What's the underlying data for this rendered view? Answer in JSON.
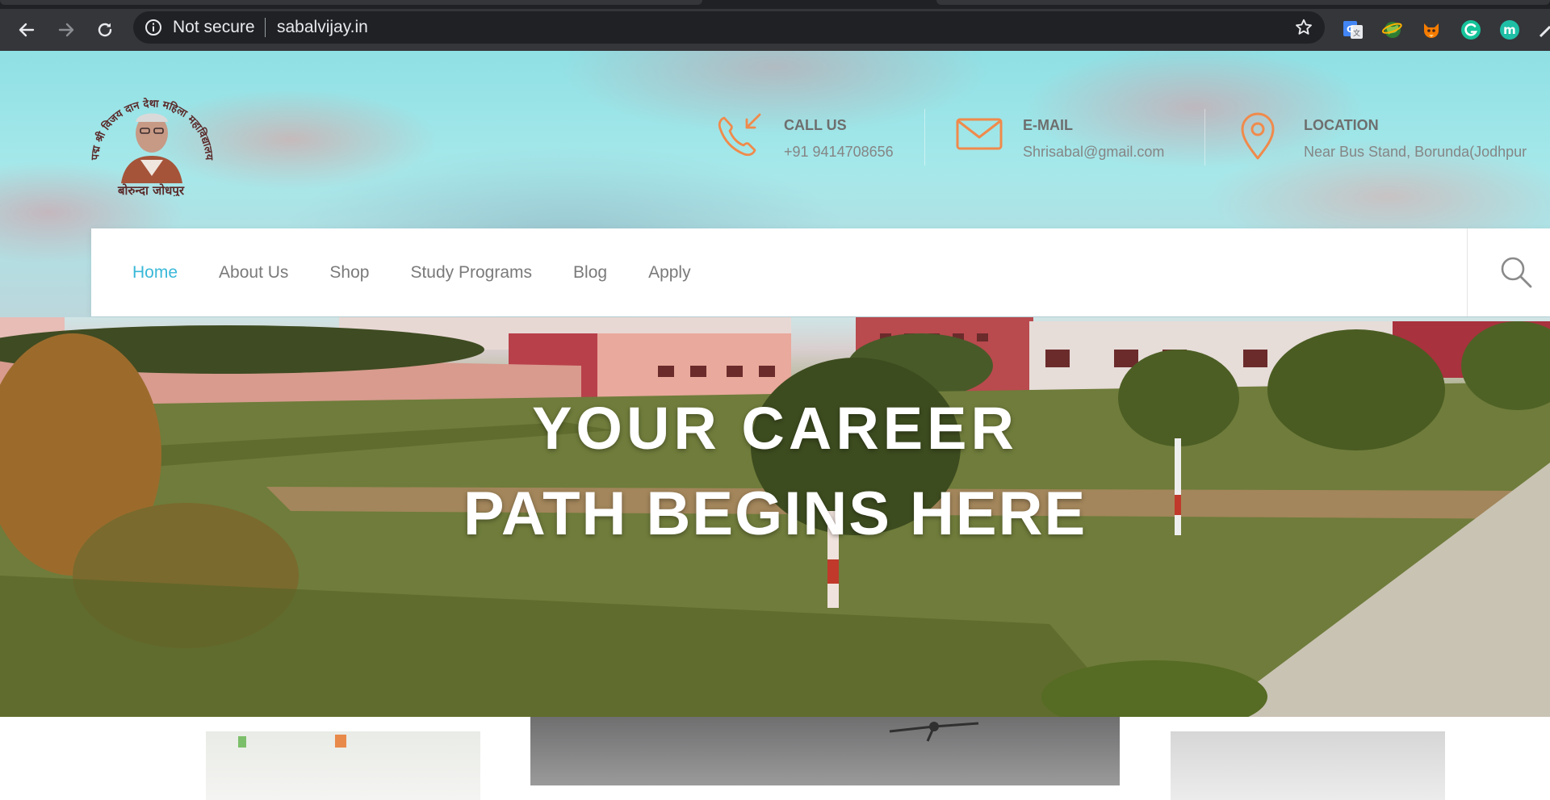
{
  "browser": {
    "security_label": "Not secure",
    "url": "sabalvijay.in",
    "extensions": [
      "google-translate-icon",
      "globe-extension-icon",
      "fox-extension-icon",
      "grammarly-icon",
      "m-extension-icon"
    ]
  },
  "site": {
    "logo": {
      "arc_text": "पद्म श्री विजय दान देथा महिला महाविद्यालय",
      "bottom_text": "बोरुन्दा जोधपुर"
    },
    "contacts": [
      {
        "title": "CALL US",
        "value": "+91 9414708656",
        "icon": "phone-icon"
      },
      {
        "title": "E-MAIL",
        "value": "Shrisabal@gmail.com",
        "icon": "mail-icon"
      },
      {
        "title": "LOCATION",
        "value": "Near Bus Stand, Borunda(Jodhpur",
        "icon": "location-pin-icon"
      }
    ],
    "nav": {
      "items": [
        {
          "label": "Home",
          "active": true
        },
        {
          "label": "About Us",
          "active": false
        },
        {
          "label": "Shop",
          "active": false
        },
        {
          "label": "Study Programs",
          "active": false
        },
        {
          "label": "Blog",
          "active": false
        },
        {
          "label": "Apply",
          "active": false
        }
      ]
    },
    "hero": {
      "line1": "YOUR CAREER",
      "line2": "PATH BEGINS HERE"
    }
  },
  "colors": {
    "accent": "#39b8d8",
    "icon_orange": "#f08a4b",
    "chrome_toolbar": "#35363a",
    "chrome_omnibox": "#202124"
  }
}
